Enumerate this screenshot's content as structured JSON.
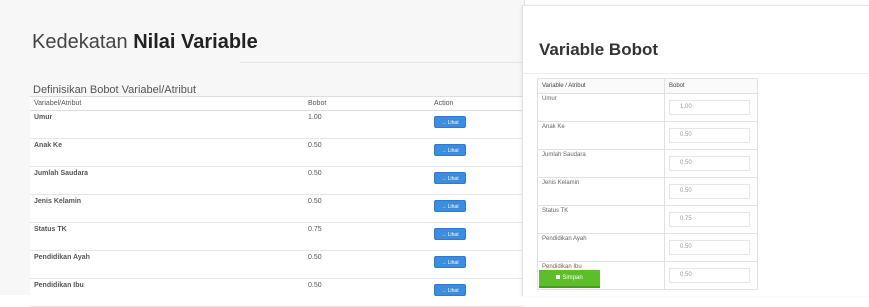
{
  "left": {
    "title_light": "Kedekatan ",
    "title_bold": "Nilai Variable",
    "subtitle": "Definisikan Bobot Variabel/Atribut",
    "headers": [
      "Variabel/Atribut",
      "Bobot",
      "Action"
    ],
    "rows": [
      {
        "name": "Umur",
        "bobot": "1.00",
        "action": "→ Lihat"
      },
      {
        "name": "Anak Ke",
        "bobot": "0.50",
        "action": "→ Lihat"
      },
      {
        "name": "Jumlah Saudara",
        "bobot": "0.50",
        "action": "→ Lihat"
      },
      {
        "name": "Jenis Kelamin",
        "bobot": "0.50",
        "action": "→ Lihat"
      },
      {
        "name": "Status TK",
        "bobot": "0.75",
        "action": "→ Lihat"
      },
      {
        "name": "Pendidikan Ayah",
        "bobot": "0.50",
        "action": "→ Lihat"
      },
      {
        "name": "Pendidikan Ibu",
        "bobot": "0.50",
        "action": "→ Lihat"
      }
    ]
  },
  "right": {
    "title": "Variable Bobot",
    "headers": [
      "Variable / Atribut",
      "Bobot"
    ],
    "rows": [
      {
        "name": "Umur",
        "bobot": "1.00"
      },
      {
        "name": "Anak Ke",
        "bobot": "0.50"
      },
      {
        "name": "Jumlah Saudara",
        "bobot": "0.50"
      },
      {
        "name": "Jenis Kelamin",
        "bobot": "0.50"
      },
      {
        "name": "Status TK",
        "bobot": "0.75"
      },
      {
        "name": "Pendidikan Ayah",
        "bobot": "0.50"
      },
      {
        "name": "Pendidikan Ibu",
        "bobot": "0.50"
      }
    ],
    "save_label": "Simpan",
    "save_icon": "save-icon"
  },
  "colors": {
    "lihat_button": "#3c8dde",
    "simpan_button": "#5cbf2a"
  }
}
